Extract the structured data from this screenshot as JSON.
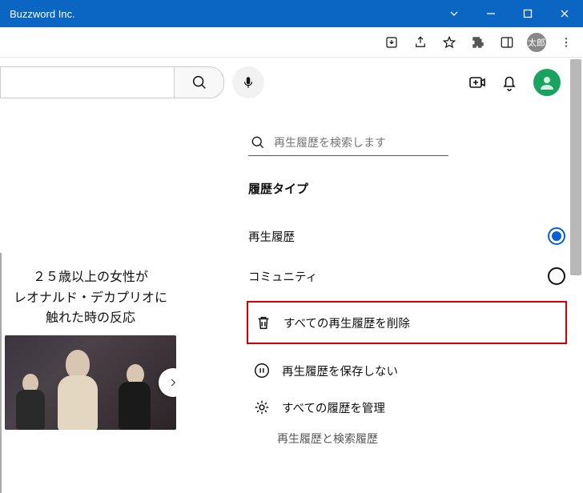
{
  "window": {
    "title": "Buzzword Inc."
  },
  "toolbar": {
    "avatar_label": "太郎"
  },
  "search": {
    "placeholder": ""
  },
  "topbar": {},
  "history_search": {
    "placeholder": "再生履歴を検索します"
  },
  "section": {
    "title": "履歴タイプ"
  },
  "radio": {
    "watch": "再生履歴",
    "community": "コミュニティ"
  },
  "actions": {
    "clear_all": "すべての再生履歴を削除",
    "pause": "再生履歴を保存しない",
    "manage": "すべての履歴を管理",
    "sub": "再生履歴と検索履歴"
  },
  "thumb": {
    "title_l1": "２５歳以上の女性が",
    "title_l2": "レオナルド・デカプリオに",
    "title_l3": "触れた時の反応"
  }
}
